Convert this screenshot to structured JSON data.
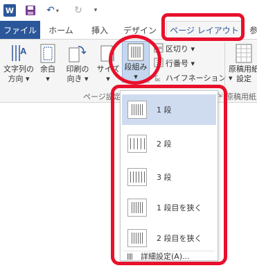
{
  "window": {
    "app_logo_letter": "W"
  },
  "quick_access": {
    "undo_glyph": "↶",
    "redo_glyph": "↻",
    "more_glyph": "▾"
  },
  "tabs": [
    {
      "label": "ファイル"
    },
    {
      "label": "ホーム"
    },
    {
      "label": "挿入"
    },
    {
      "label": "デザイン"
    },
    {
      "label": "ページ レイアウト"
    },
    {
      "label": "参"
    }
  ],
  "ribbon": {
    "direction": {
      "line1": "文字列の",
      "line2": "方向 ▾"
    },
    "margins": {
      "line1": "余白",
      "line2": "▾"
    },
    "orientation": {
      "line1": "印刷の",
      "line2": "向き ▾"
    },
    "size": {
      "line1": "サイズ",
      "line2": "▾"
    },
    "columns": {
      "line1": "段組み",
      "line2": "▾"
    },
    "breaks": "区切り ▾",
    "line_numbers": "行番号 ▾",
    "hyphenation": "ハイフネーション ▾",
    "genko": {
      "line1": "原稿用紙",
      "line2": "設定"
    },
    "group_page_setup": "ページ設定",
    "group_genko": "原稿用紙"
  },
  "columns_menu": {
    "items": [
      {
        "label": "1 段",
        "bars": 1
      },
      {
        "label": "2 段",
        "bars": 2
      },
      {
        "label": "3 段",
        "bars": 3
      },
      {
        "label": "1 段目を狭く",
        "bars": 2
      },
      {
        "label": "2 段目を狭く",
        "bars": 2
      }
    ],
    "more_label": "詳細設定(A)..."
  },
  "colors": {
    "accent": "#2b579a",
    "hover": "#cfdcf0",
    "callout": "#e8102c"
  }
}
